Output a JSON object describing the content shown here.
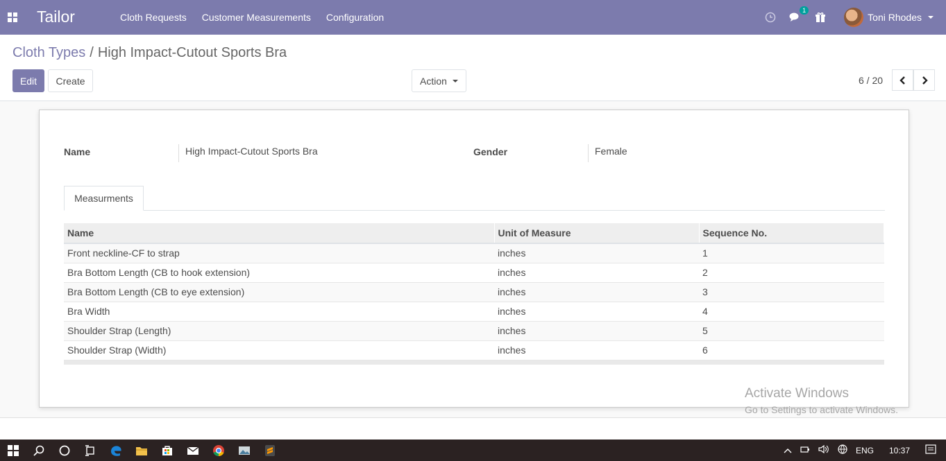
{
  "app": {
    "brand": "Tailor"
  },
  "nav": {
    "menu": [
      "Cloth Requests",
      "Customer Measurements",
      "Configuration"
    ],
    "messages_badge": "1",
    "user_name": "Toni Rhodes"
  },
  "breadcrumb": {
    "parent": "Cloth Types",
    "separator": "/",
    "current": "High Impact-Cutout Sports Bra"
  },
  "buttons": {
    "edit": "Edit",
    "create": "Create",
    "action": "Action"
  },
  "pager": {
    "value": "6 / 20"
  },
  "form": {
    "name_label": "Name",
    "name_value": "High Impact-Cutout Sports Bra",
    "gender_label": "Gender",
    "gender_value": "Female",
    "tab_label": "Measurments"
  },
  "table": {
    "headers": [
      "Name",
      "Unit of Measure",
      "Sequence No."
    ],
    "rows": [
      [
        "Front neckline-CF to strap",
        "inches",
        "1"
      ],
      [
        "Bra Bottom Length (CB to hook extension)",
        "inches",
        "2"
      ],
      [
        "Bra Bottom Length (CB to eye extension)",
        "inches",
        "3"
      ],
      [
        "Bra Width",
        "inches",
        "4"
      ],
      [
        "Shoulder Strap (Length)",
        "inches",
        "5"
      ],
      [
        "Shoulder Strap (Width)",
        "inches",
        "6"
      ]
    ]
  },
  "watermark": {
    "line1": "Activate Windows",
    "line2": "Go to Settings to activate Windows."
  },
  "taskbar": {
    "lang": "ENG",
    "time": "10:37"
  },
  "colors": {
    "brand": "#7c7bad",
    "badge": "#00a09d"
  }
}
